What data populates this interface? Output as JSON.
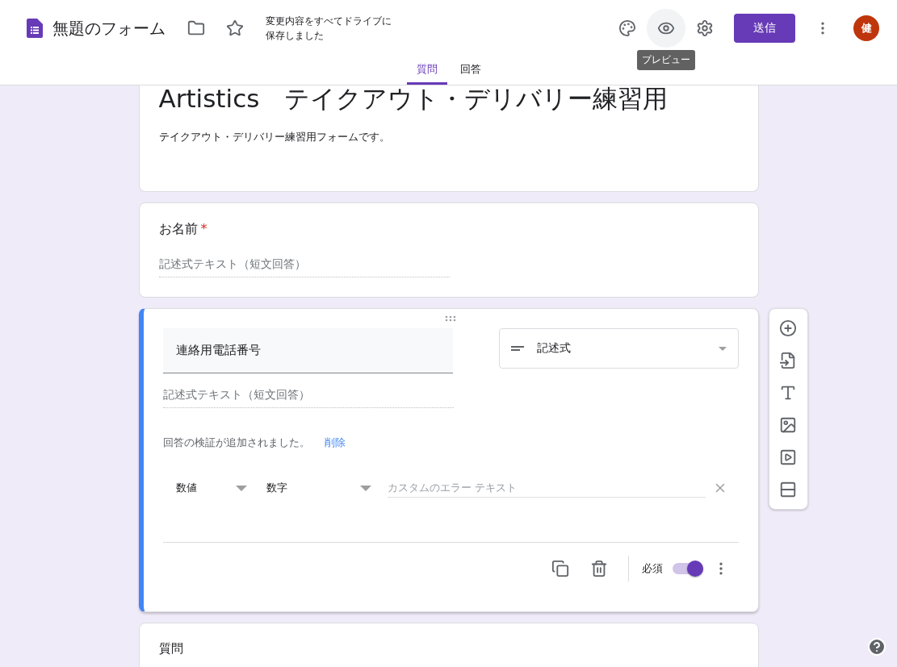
{
  "header": {
    "app_title": "無題のフォーム",
    "save_status": "変更内容をすべてドライブに保存しました",
    "send_button": "送信",
    "avatar_initial": "健",
    "tooltip": "プレビュー",
    "tabs": [
      {
        "label": "質問",
        "selected": true
      },
      {
        "label": "回答",
        "selected": false
      }
    ]
  },
  "form": {
    "title": "Artistics　テイクアウト・デリバリー練習用",
    "description": "テイクアウト・デリバリー練習用フォームです。"
  },
  "questions": [
    {
      "kind": "short",
      "title": "お名前",
      "required": true,
      "required_mark": "*",
      "placeholder": "記述式テキスト（短文回答）"
    },
    {
      "kind": "editing",
      "title": "連絡用電話番号",
      "type_label": "記述式",
      "placeholder": "記述式テキスト（短文回答）",
      "validation_message": "回答の検証が追加されました。",
      "remove_link": "削除",
      "validation_type": "数値",
      "validation_condition": "数字",
      "error_placeholder": "カスタムのエラー テキスト",
      "required_label": "必須",
      "required": true
    },
    {
      "kind": "collapsed",
      "title": "質問"
    }
  ]
}
